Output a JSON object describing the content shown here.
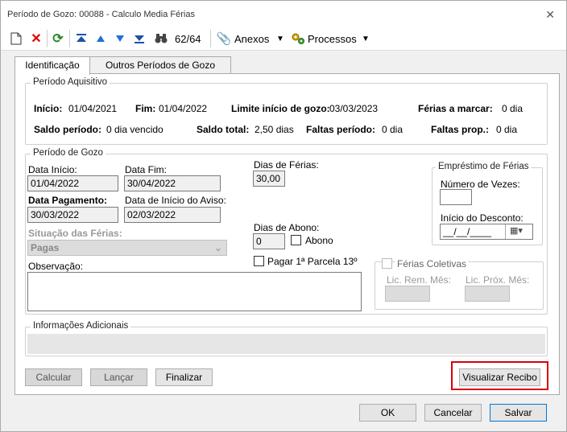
{
  "window": {
    "title": "Período de Gozo: 00088 - Calculo Media Férias"
  },
  "toolbar": {
    "record_count": "62/64",
    "anexos_label": "Anexos",
    "processos_label": "Processos"
  },
  "tabs": [
    "Identificação",
    "Outros Períodos de Gozo"
  ],
  "periodo_aquisitivo": {
    "legend": "Período Aquisitivo",
    "inicio_label": "Início:",
    "inicio_value": "01/04/2021",
    "fim_label": "Fim:",
    "fim_value": "01/04/2022",
    "limite_label": "Limite início de gozo:",
    "limite_value": "03/03/2023",
    "ferias_marcar_label": "Férias a marcar:",
    "ferias_marcar_value": "0 dia",
    "saldo_periodo_label": "Saldo período:",
    "saldo_periodo_value": "0 dia vencido",
    "saldo_total_label": "Saldo total:",
    "saldo_total_value": "2,50 dias",
    "faltas_periodo_label": "Faltas período:",
    "faltas_periodo_value": "0 dia",
    "faltas_prop_label": "Faltas prop.:",
    "faltas_prop_value": "0 dia"
  },
  "periodo_gozo": {
    "legend": "Período de Gozo",
    "data_inicio_label": "Data Início:",
    "data_inicio_value": "01/04/2022",
    "data_fim_label": "Data Fim:",
    "data_fim_value": "30/04/2022",
    "dias_ferias_label": "Dias de Férias:",
    "dias_ferias_value": "30,00",
    "data_pagamento_label": "Data Pagamento:",
    "data_pagamento_value": "30/03/2022",
    "data_aviso_label": "Data de Início do Aviso:",
    "data_aviso_value": "02/03/2022",
    "situacao_label": "Situação das Férias:",
    "situacao_value": "Pagas",
    "dias_abono_label": "Dias de Abono:",
    "dias_abono_value": "0",
    "abono_label": "Abono",
    "pagar_parcela_label": "Pagar 1ª Parcela 13º",
    "observacao_label": "Observação:"
  },
  "emprestimo": {
    "legend": "Empréstimo de Férias",
    "numero_vezes_label": "Número de Vezes:",
    "inicio_desconto_label": "Início do Desconto:",
    "inicio_desconto_value": "__/__/____"
  },
  "ferias_coletivas": {
    "label": "Férias Coletivas",
    "lic_rem_label": "Lic. Rem. Mês:",
    "lic_prox_label": "Lic. Próx. Mês:"
  },
  "informacoes": {
    "legend": "Informações Adicionais"
  },
  "actions": {
    "calcular": "Calcular",
    "lancar": "Lançar",
    "finalizar": "Finalizar",
    "visualizar": "Visualizar Recibo"
  },
  "footer": {
    "ok": "OK",
    "cancelar": "Cancelar",
    "salvar": "Salvar"
  },
  "colors": {
    "highlight": "#d9000d"
  }
}
